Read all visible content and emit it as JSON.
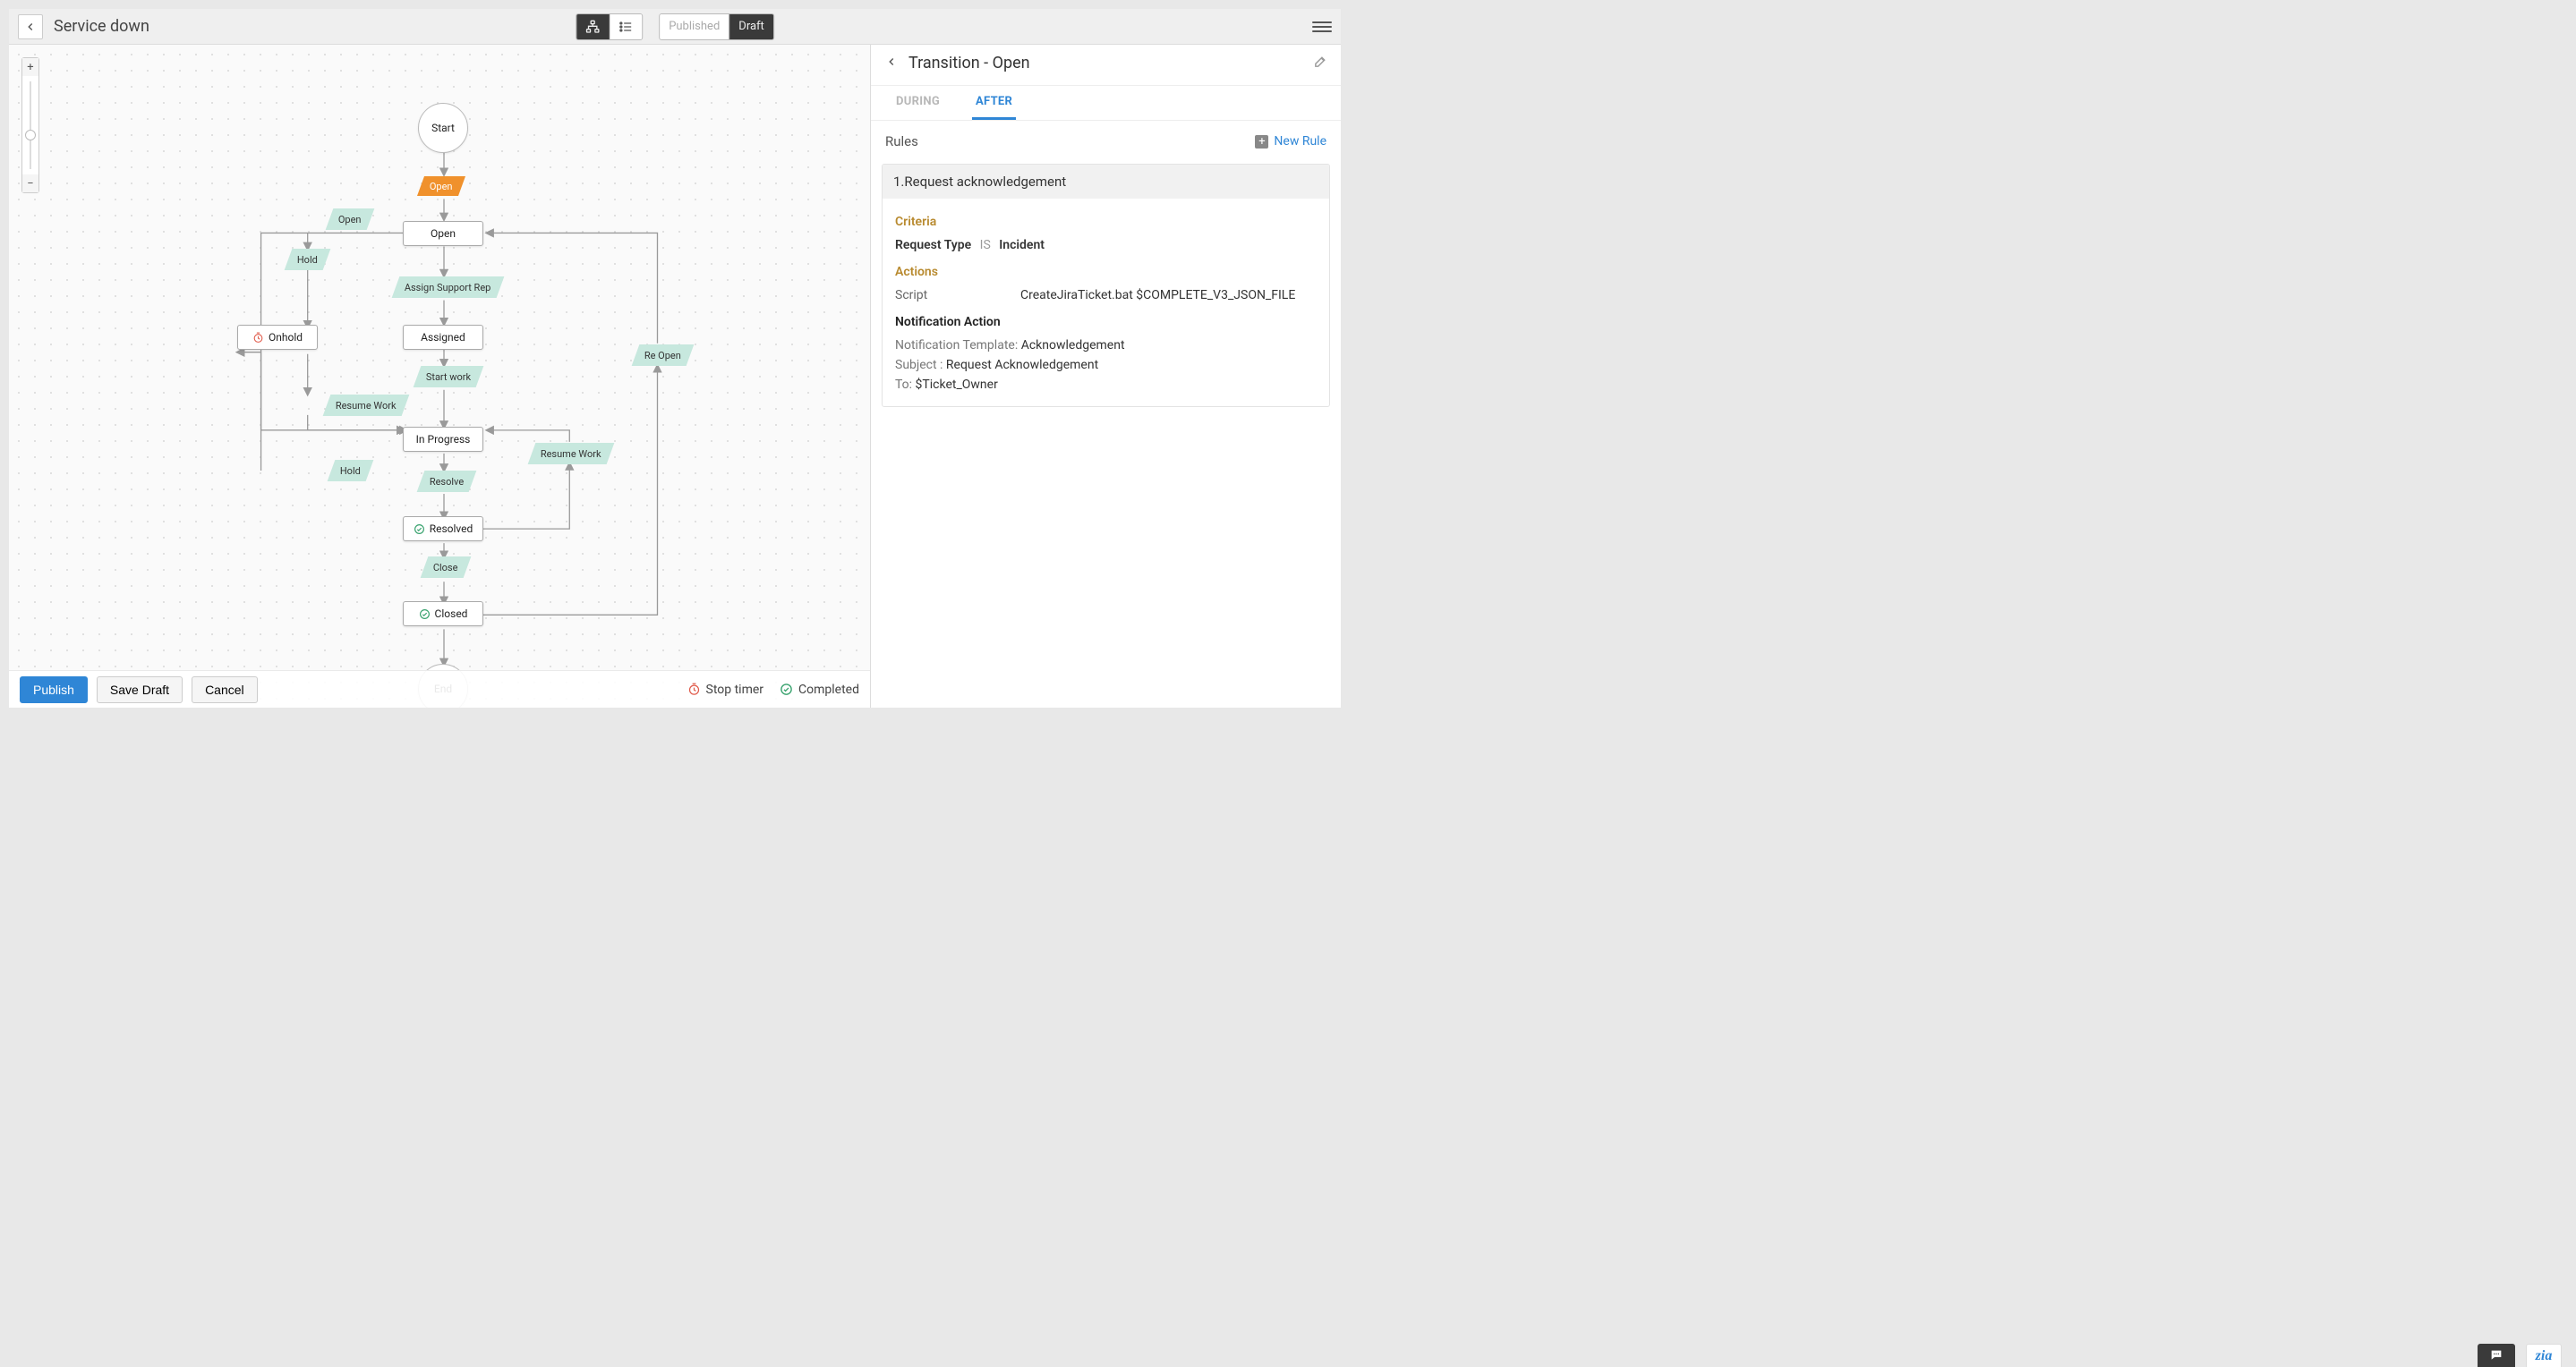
{
  "header": {
    "page_title": "Service down",
    "view_toggle": {
      "diagram_icon": "diagram-icon",
      "list_icon": "list-icon"
    },
    "pub_toggle": {
      "published_label": "Published",
      "draft_label": "Draft"
    }
  },
  "canvas": {
    "nodes": {
      "start": "Start",
      "end": "End",
      "open": "Open",
      "assigned": "Assigned",
      "in_progress": "In Progress",
      "onhold": "Onhold",
      "resolved": "Resolved",
      "closed": "Closed"
    },
    "transitions": {
      "open_state": "Open",
      "open_t": "Open",
      "assign": "Assign Support Rep",
      "start_work": "Start work",
      "hold_top": "Hold",
      "hold_bottom": "Hold",
      "resume_top": "Resume Work",
      "resume_right": "Resume Work",
      "resolve": "Resolve",
      "close": "Close",
      "reopen": "Re Open"
    },
    "footer": {
      "publish": "Publish",
      "save_draft": "Save Draft",
      "cancel": "Cancel",
      "legend_timer": "Stop timer",
      "legend_completed": "Completed"
    }
  },
  "side": {
    "title": "Transition - Open",
    "tabs": {
      "during": "DURING",
      "after": "AFTER"
    },
    "rules_label": "Rules",
    "new_rule": "New Rule",
    "rule": {
      "title": "1.Request acknowledgement",
      "criteria_label": "Criteria",
      "criteria_field": "Request Type",
      "criteria_op": "IS",
      "criteria_value": "Incident",
      "actions_label": "Actions",
      "script_label": "Script",
      "script_value": "CreateJiraTicket.bat $COMPLETE_V3_JSON_FILE",
      "notif_head": "Notification Action",
      "notif_template_label": "Notification Template:",
      "notif_template_value": "Acknowledgement",
      "subject_label": "Subject :",
      "subject_value": "Request Acknowledgement",
      "to_label": "To:",
      "to_value": "$Ticket_Owner"
    }
  },
  "fab": {
    "zia": "zia"
  }
}
